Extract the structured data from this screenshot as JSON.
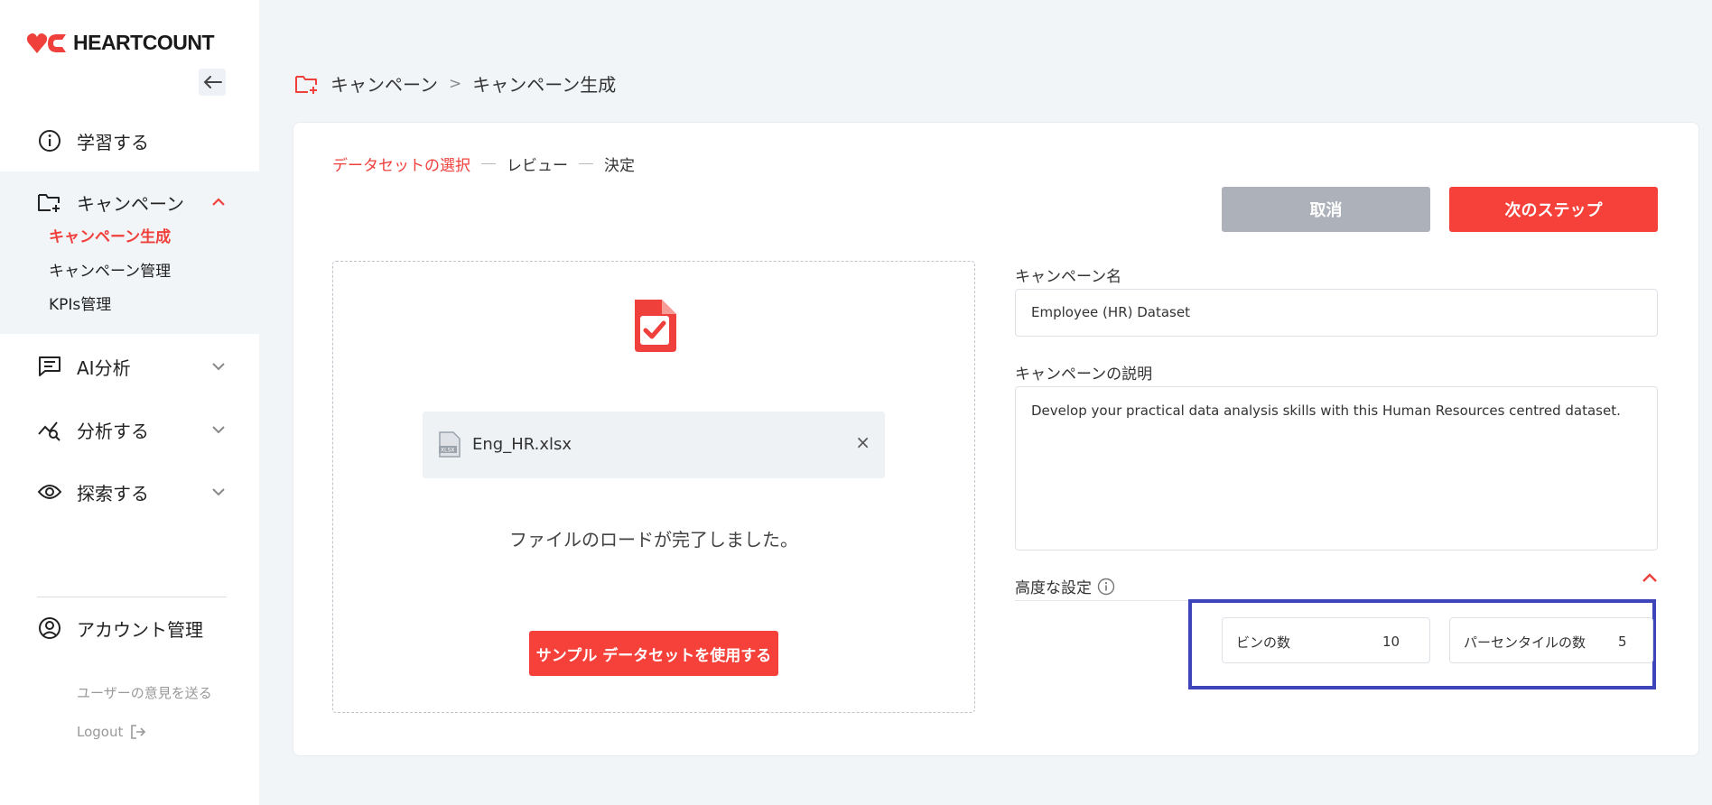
{
  "brand": {
    "name": "HEARTCOUNT",
    "accent": "#f0403c"
  },
  "sidebar": {
    "learn": "学習する",
    "campaign": "キャンペーン",
    "campaign_sub": [
      "キャンペーン生成",
      "キャンペーン管理",
      "KPIs管理"
    ],
    "ai": "AI分析",
    "analyze": "分析する",
    "explore": "探索する",
    "account": "アカウント管理",
    "feedback": "ユーザーの意見を送る",
    "logout": "Logout"
  },
  "breadcrumb": {
    "root": "キャンペーン",
    "sep": ">",
    "current": "キャンペーン生成"
  },
  "steps": [
    "データセットの選択",
    "レビュー",
    "決定"
  ],
  "buttons": {
    "cancel": "取消",
    "next": "次のステップ",
    "sample": "サンプル データセットを使用する"
  },
  "upload": {
    "filename": "Eng_HR.xlsx",
    "close": "×",
    "message": "ファイルのロードが完了しました。"
  },
  "form": {
    "name_label": "キャンペーン名",
    "name_value": "Employee (HR) Dataset",
    "desc_label": "キャンペーンの説明",
    "desc_value": "Develop your practical data analysis skills with this Human Resources centred dataset.",
    "advanced_label": "高度な設定",
    "bins_label": "ビンの数",
    "bins_value": "10",
    "percentile_label": "パーセンタイルの数",
    "percentile_value": "5"
  }
}
